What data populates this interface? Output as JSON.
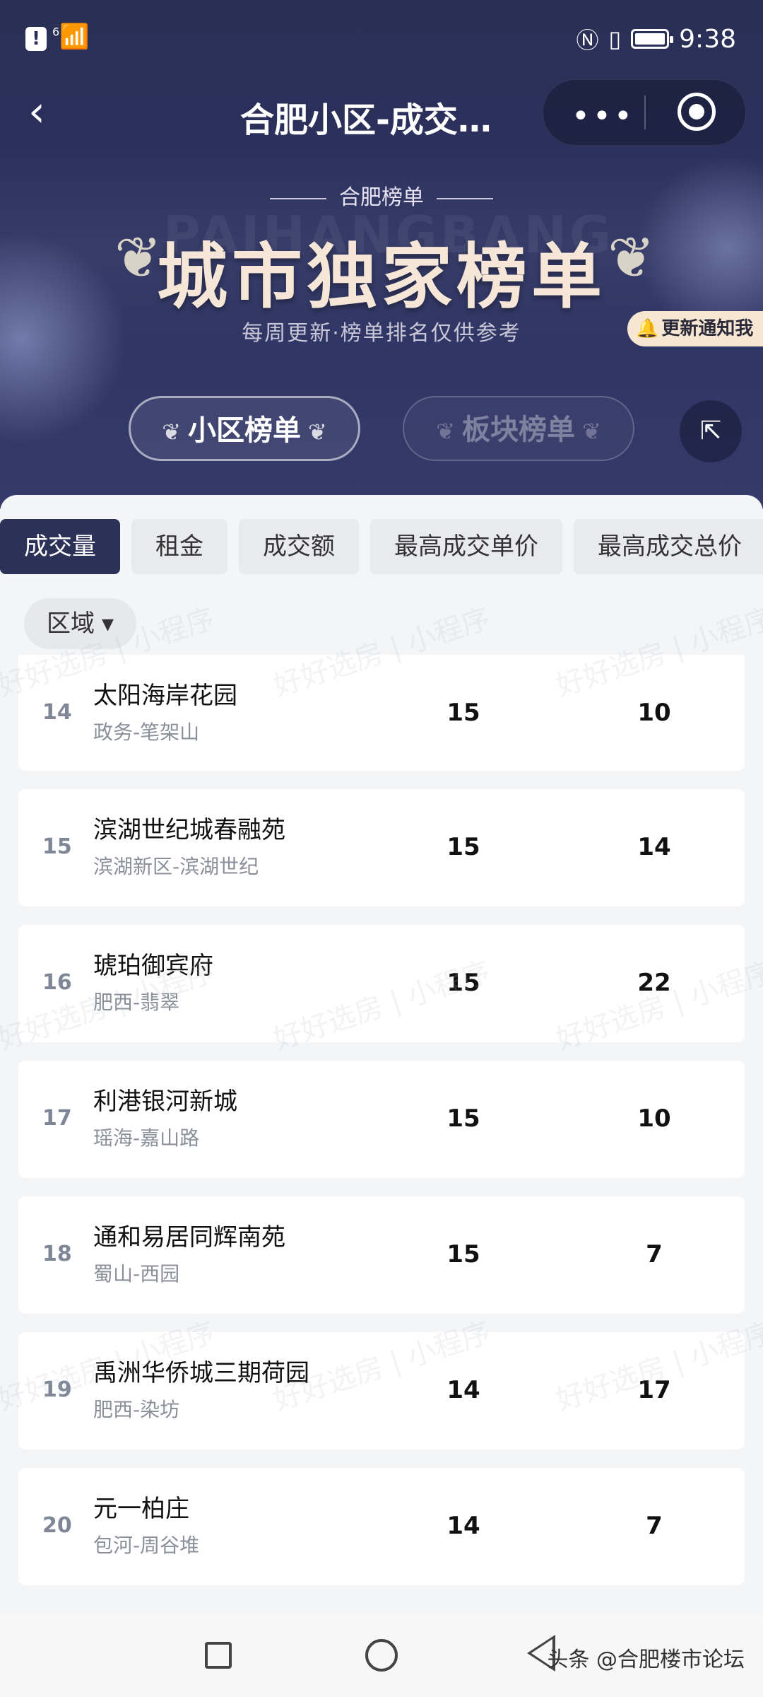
{
  "status_bar": {
    "time": "9:38",
    "signal": "6"
  },
  "header": {
    "title": "合肥小区-成交…",
    "more": "•••"
  },
  "hero": {
    "kicker": "合肥榜单",
    "bg_text": "PAIHANGBANG",
    "title": "城市独家榜单",
    "tagline": "每周更新·榜单排名仅供参考",
    "notify_label": "更新通知我",
    "toggles": [
      {
        "label": "小区榜单",
        "active": true
      },
      {
        "label": "板块榜单",
        "active": false
      }
    ]
  },
  "tabs": [
    {
      "label": "成交量",
      "active": true
    },
    {
      "label": "租金",
      "active": false
    },
    {
      "label": "成交额",
      "active": false
    },
    {
      "label": "最高成交单价",
      "active": false
    },
    {
      "label": "最高成交总价",
      "active": false
    }
  ],
  "filter": {
    "label": "区域"
  },
  "rows": [
    {
      "rank": "14",
      "name": "太阳海岸花园",
      "area": "政务-笔架山",
      "v1": "15",
      "v2": "10"
    },
    {
      "rank": "15",
      "name": "滨湖世纪城春融苑",
      "area": "滨湖新区-滨湖世纪",
      "v1": "15",
      "v2": "14"
    },
    {
      "rank": "16",
      "name": "琥珀御宾府",
      "area": "肥西-翡翠",
      "v1": "15",
      "v2": "22"
    },
    {
      "rank": "17",
      "name": "利港银河新城",
      "area": "瑶海-嘉山路",
      "v1": "15",
      "v2": "10"
    },
    {
      "rank": "18",
      "name": "通和易居同辉南苑",
      "area": "蜀山-西园",
      "v1": "15",
      "v2": "7"
    },
    {
      "rank": "19",
      "name": "禹洲华侨城三期荷园",
      "area": "肥西-染坊",
      "v1": "14",
      "v2": "17"
    },
    {
      "rank": "20",
      "name": "元一柏庄",
      "area": "包河-周谷堆",
      "v1": "14",
      "v2": "7"
    }
  ],
  "watermark": "好好选房 | 小程序",
  "footer": {
    "credit": "头条 @合肥楼市论坛"
  }
}
